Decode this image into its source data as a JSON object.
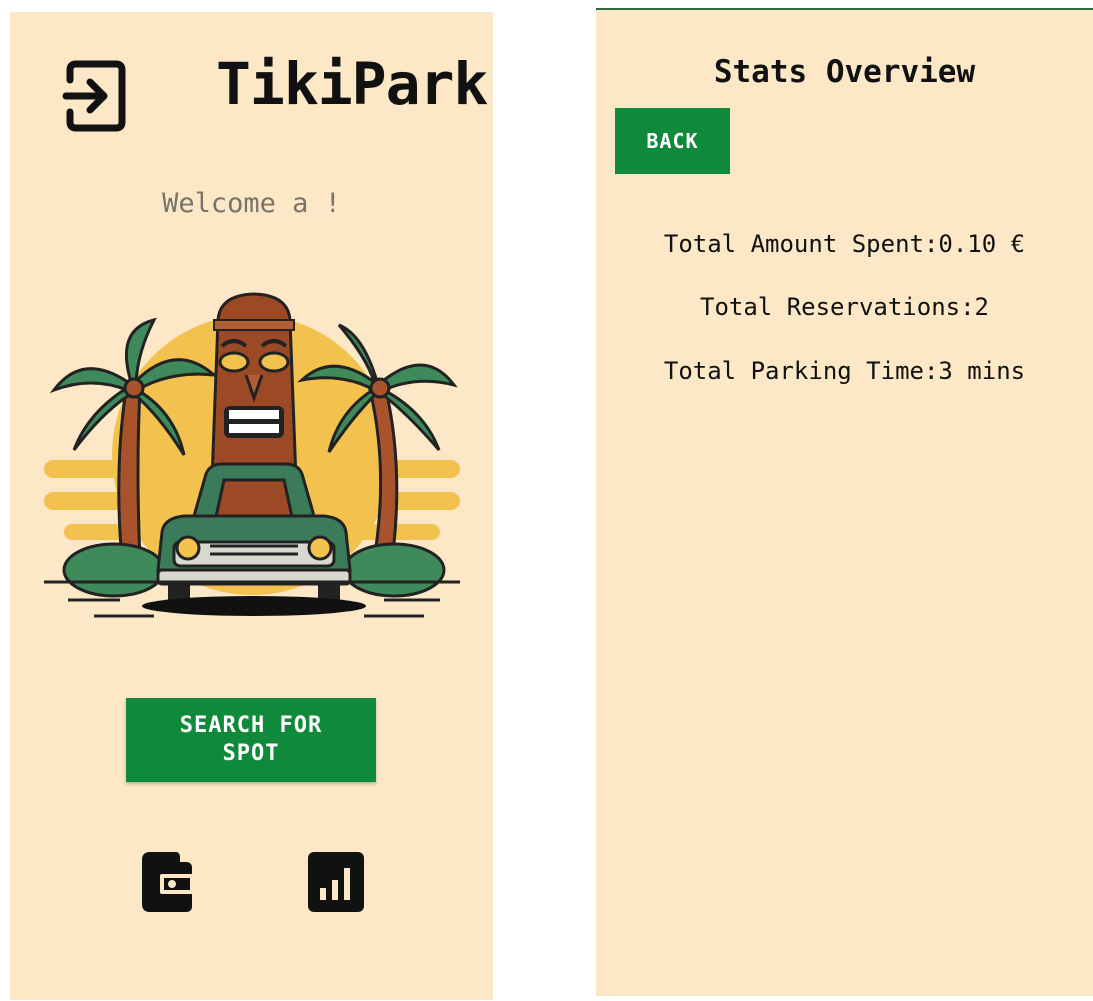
{
  "home": {
    "app_title": "TikiPark",
    "welcome_text": "Welcome a !",
    "search_button_label": "SEARCH FOR SPOT",
    "icons": {
      "logout": "logout-icon",
      "wallet": "wallet-icon",
      "stats": "bar-chart-icon"
    }
  },
  "stats": {
    "title": "Stats Overview",
    "back_label": "BACK",
    "total_amount": "Total Amount Spent:0.10 €",
    "total_reservations": "Total Reservations:2",
    "total_parking_time": "Total Parking Time:3 mins"
  },
  "colors": {
    "background": "#fce8c6",
    "primary_button": "#0f8a3a",
    "text": "#111111",
    "muted_text": "#7a7368"
  }
}
